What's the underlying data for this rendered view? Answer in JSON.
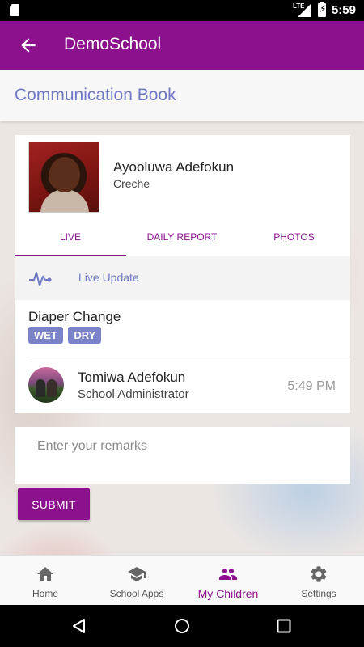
{
  "status_bar": {
    "network": "LTE",
    "time": "5:59"
  },
  "app_bar": {
    "title": "DemoSchool"
  },
  "page": {
    "title": "Communication Book"
  },
  "child": {
    "name": "Ayooluwa Adefokun",
    "class": "Creche"
  },
  "tabs": [
    {
      "label": "LIVE",
      "active": true
    },
    {
      "label": "DAILY REPORT",
      "active": false
    },
    {
      "label": "PHOTOS",
      "active": false
    }
  ],
  "live": {
    "label": "Live Update"
  },
  "event": {
    "title": "Diaper Change",
    "tags": [
      "WET",
      "DRY"
    ],
    "author_name": "Tomiwa Adefokun",
    "author_role": "School Administrator",
    "time": "5:49 PM"
  },
  "remarks": {
    "placeholder": "Enter your remarks",
    "value": ""
  },
  "submit": {
    "label": "SUBMIT"
  },
  "bottom_nav": [
    {
      "label": "Home",
      "icon": "home-icon",
      "active": false
    },
    {
      "label": "School Apps",
      "icon": "graduation-cap-icon",
      "active": false
    },
    {
      "label": "My Children",
      "icon": "people-icon",
      "active": true
    },
    {
      "label": "Settings",
      "icon": "gear-icon",
      "active": false
    }
  ],
  "colors": {
    "primary": "#8c118c",
    "accent": "#6f79c5",
    "tag": "#7b83c8"
  }
}
